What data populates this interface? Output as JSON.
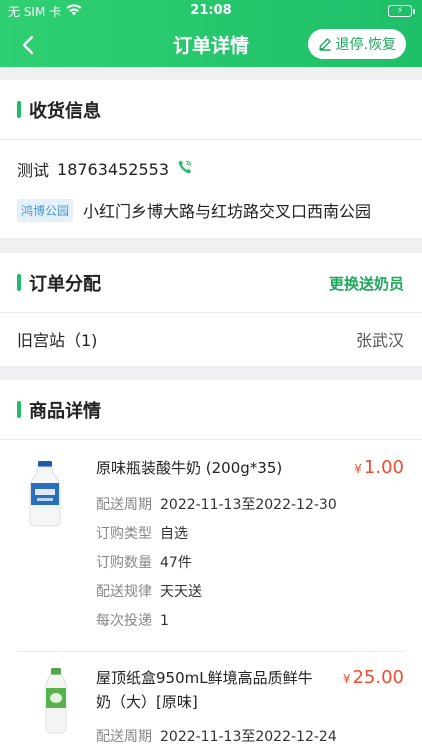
{
  "status_bar": {
    "carrier": "无 SIM 卡",
    "time": "21:08",
    "battery": "⚡"
  },
  "nav": {
    "title": "订单详情",
    "action_label": "退停.恢复"
  },
  "shipping": {
    "section_title": "收货信息",
    "name": "测试",
    "phone": "18763452553",
    "tag": "鸿博公园",
    "address": "小红门乡博大路与红坊路交叉口西南公园"
  },
  "assignment": {
    "section_title": "订单分配",
    "change_label": "更换送奶员",
    "station": "旧宫站（1)",
    "courier": "张武汉"
  },
  "products": {
    "section_title": "商品详情",
    "items": [
      {
        "name": "原味瓶装酸牛奶 (200g*35)",
        "currency": "¥",
        "price": "1.00",
        "period_label": "配送周期",
        "period": "2022-11-13至2022-12-30",
        "type_label": "订购类型",
        "type": "自选",
        "qty_label": "订购数量",
        "qty": "47件",
        "rule_label": "配送规律",
        "rule": "天天送",
        "each_label": "每次投递",
        "each": "1"
      },
      {
        "name": "屋顶纸盒950mL鲜境高品质鲜牛奶（大）[原味]",
        "currency": "¥",
        "price": "25.00",
        "period_label": "配送周期",
        "period": "2022-11-13至2022-12-24"
      }
    ]
  },
  "colors": {
    "accent": "#1fbf6a",
    "price": "#f24b2b",
    "tag_bg": "#e4f1fb"
  }
}
